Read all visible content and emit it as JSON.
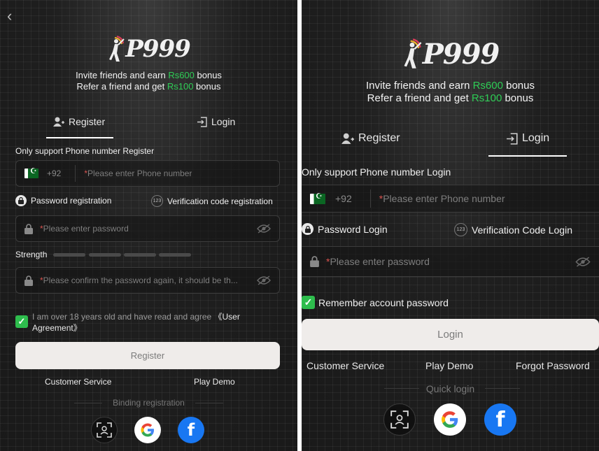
{
  "colors": {
    "accent_green": "#2ecc55",
    "background": "#1c1c1c",
    "button": "#efecea",
    "facebook": "#1877f2",
    "required": "#d9534f"
  },
  "logo": {
    "text": "P999"
  },
  "register_panel": {
    "back_icon": "chevron-left-icon",
    "promo": {
      "line1_pre": "Invite friends and earn ",
      "line1_amount": "Rs600",
      "line1_post": " bonus",
      "line2_pre": "Refer a friend and get ",
      "line2_amount": "Rs100",
      "line2_post": " bonus"
    },
    "tabs": {
      "register": "Register",
      "login": "Login",
      "active": "register"
    },
    "notice": "Only support Phone number Register",
    "phone": {
      "country_code": "+92",
      "placeholder": "Please enter Phone number"
    },
    "modes": {
      "password": "Password registration",
      "verification": "Verification code registration",
      "verification_badge": "123"
    },
    "password": {
      "placeholder": "Please enter password"
    },
    "strength": {
      "label": "Strength",
      "segments": 4
    },
    "confirm": {
      "placeholder": "Please confirm the password again, it should be th..."
    },
    "agreement": {
      "checked": true,
      "text": "I am over 18 years old and have read and agree ",
      "link": "《User Agreement》"
    },
    "submit_label": "Register",
    "links": {
      "customer_service": "Customer Service",
      "play_demo": "Play Demo"
    },
    "divider_label": "Binding registration",
    "social": [
      "face-id-icon",
      "google-icon",
      "facebook-icon"
    ]
  },
  "login_panel": {
    "promo": {
      "line1_pre": "Invite friends and earn ",
      "line1_amount": "Rs600",
      "line1_post": " bonus",
      "line2_pre": "Refer a friend and get ",
      "line2_amount": "Rs100",
      "line2_post": " bonus"
    },
    "tabs": {
      "register": "Register",
      "login": "Login",
      "active": "login"
    },
    "notice": "Only support Phone number Login",
    "phone": {
      "country_code": "+92",
      "placeholder": "Please enter Phone number"
    },
    "modes": {
      "password": "Password Login",
      "verification": "Verification Code Login",
      "verification_badge": "123"
    },
    "password": {
      "placeholder": "Please enter password"
    },
    "remember": {
      "checked": true,
      "label": "Remember account password"
    },
    "submit_label": "Login",
    "links": {
      "customer_service": "Customer Service",
      "play_demo": "Play Demo",
      "forgot_password": "Forgot Password"
    },
    "divider_label": "Quick login",
    "social": [
      "face-id-icon",
      "google-icon",
      "facebook-icon"
    ]
  }
}
